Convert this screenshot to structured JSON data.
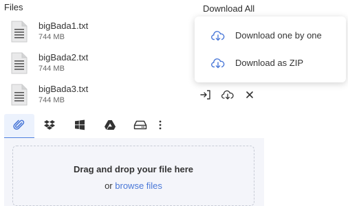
{
  "header": {
    "files_label": "Files",
    "download_all": "Download All"
  },
  "files": [
    {
      "name": "bigBada1.txt",
      "size": "744 MB"
    },
    {
      "name": "bigBada2.txt",
      "size": "744 MB"
    },
    {
      "name": "bigBada3.txt",
      "size": "744 MB"
    }
  ],
  "row_actions": [
    {
      "icon": "move-into-icon"
    },
    {
      "icon": "download-icon"
    },
    {
      "icon": "close-icon"
    }
  ],
  "dropdown": {
    "items": [
      {
        "label": "Download one by one",
        "icon": "cloud-download-icon"
      },
      {
        "label": "Download as ZIP",
        "icon": "cloud-download-icon"
      }
    ]
  },
  "source_tabs": [
    {
      "icon": "paperclip-icon",
      "active": true
    },
    {
      "icon": "dropbox-icon"
    },
    {
      "icon": "windows-onedrive-icon"
    },
    {
      "icon": "google-drive-icon"
    },
    {
      "icon": "hard-drive-icon"
    },
    {
      "icon": "more-vertical-icon"
    }
  ],
  "dropzone": {
    "title": "Drag and drop your file here",
    "or_text": "or",
    "browse_link": "browse files"
  },
  "colors": {
    "accent": "#4a78d8",
    "dropzone_bg": "#f4f5fa",
    "tab_active_bg": "#ecf2fd"
  }
}
